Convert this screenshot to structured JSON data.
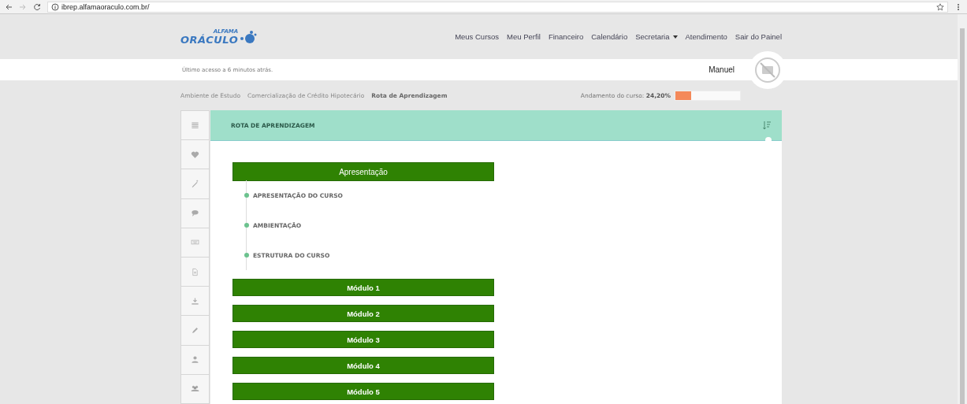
{
  "browser": {
    "url": "ibrep.alfamaoraculo.com.br/"
  },
  "logo": {
    "top": "ALFAMA",
    "main": "ORÁCULO"
  },
  "nav": [
    {
      "label": "Meus Cursos",
      "dropdown": false
    },
    {
      "label": "Meu Perfil",
      "dropdown": false
    },
    {
      "label": "Financeiro",
      "dropdown": false
    },
    {
      "label": "Calendário",
      "dropdown": false
    },
    {
      "label": "Secretaria",
      "dropdown": true
    },
    {
      "label": "Atendimento",
      "dropdown": false
    },
    {
      "label": "Sair do Painel",
      "dropdown": false
    }
  ],
  "user_bar": {
    "last_access": "Último acesso a 6 minutos atrás.",
    "user_name": "Manuel"
  },
  "breadcrumb": [
    {
      "label": "Ambiente de Estudo",
      "current": false
    },
    {
      "label": "Comercialização de Crédito Hipotecário",
      "current": false
    },
    {
      "label": "Rota de Aprendizagem",
      "current": true
    }
  ],
  "progress": {
    "label": "Andamento do curso:",
    "value": "24,20%",
    "level": 0.242
  },
  "panel": {
    "title": "ROTA DE APRENDIZAGEM"
  },
  "sections": [
    {
      "title": "Apresentação",
      "expanded": true,
      "items": [
        "APRESENTAÇÃO DO CURSO",
        "AMBIENTAÇÃO",
        "ESTRUTURA DO CURSO"
      ]
    },
    {
      "title": "Módulo 1",
      "expanded": false
    },
    {
      "title": "Módulo 2",
      "expanded": false
    },
    {
      "title": "Módulo 3",
      "expanded": false
    },
    {
      "title": "Módulo 4",
      "expanded": false
    },
    {
      "title": "Módulo 5",
      "expanded": false
    }
  ]
}
